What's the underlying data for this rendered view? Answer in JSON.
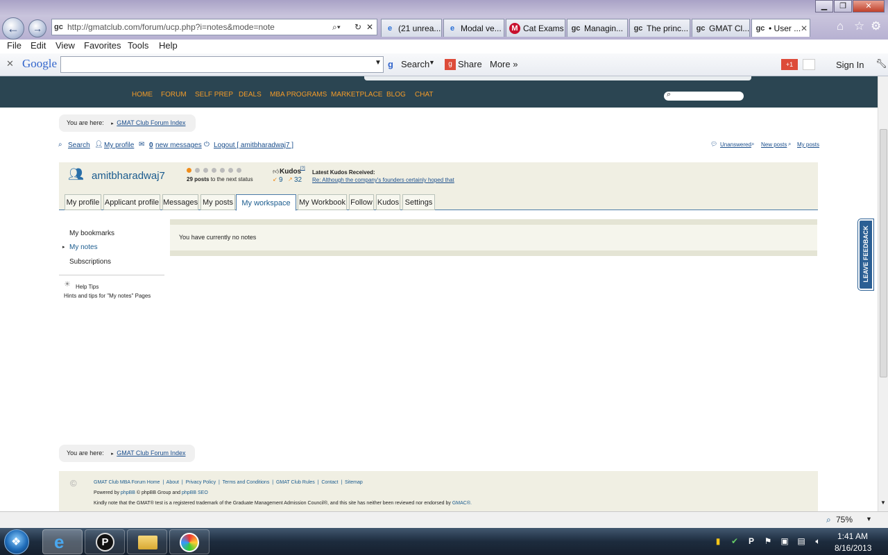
{
  "browser": {
    "url": "http://gmatclub.com/forum/ucp.php?i=notes&mode=note",
    "tabs": [
      "(21 unrea...",
      "Modal ve...",
      "Cat Exams",
      "Managin...",
      "The princ...",
      "GMAT Cl...",
      "• User ..."
    ],
    "tab_icons": [
      "ie-icon",
      "ie-icon",
      "cat-icon",
      "gc-icon",
      "gc-icon",
      "gc-icon",
      "gc-icon"
    ],
    "menu": [
      "File",
      "Edit",
      "View",
      "Favorites",
      "Tools",
      "Help"
    ],
    "google_toolbar": {
      "logo": "Google",
      "search": "Search",
      "share": "Share",
      "more": "More",
      "sign_in": "Sign In",
      "plus_one": "+1"
    },
    "zoom": "75%"
  },
  "site_nav": [
    "HOME",
    "FORUM",
    "SELF PREP",
    "DEALS",
    "MBA PROGRAMS",
    "MARKETPLACE",
    "BLOG",
    "CHAT"
  ],
  "breadcrumb": {
    "label": "You are here:",
    "link": "GMAT Club Forum Index"
  },
  "user_links": {
    "search": "Search",
    "profile": "My profile",
    "messages_count": "0",
    "messages": "new messages",
    "logout": "Logout [ amitbharadwaj7 ]"
  },
  "right_links": [
    "Unanswered",
    "New posts",
    "My posts"
  ],
  "profile": {
    "username": "amitbharadwaj7",
    "posts_count": "29 posts",
    "posts_text": "to the next status",
    "kudos_label": "Kudos",
    "kudos_superscript": "[?]",
    "kudos_given": "9",
    "kudos_received": "32",
    "latest_kudos_label": "Latest Kudos Received:",
    "latest_kudos_link": "Re: Although the company's founders certainly hoped that"
  },
  "profile_tabs": [
    "My profile",
    "Applicant profile",
    "Messages",
    "My posts",
    "My workspace",
    "My Workbook",
    "Follow",
    "Kudos",
    "Settings"
  ],
  "sidebar": {
    "items": [
      "My bookmarks",
      "My notes",
      "Subscriptions"
    ],
    "help_title": "Help Tips",
    "help_text": "Hints and tips for \"My notes\" Pages"
  },
  "notes_message": "You have currently no notes",
  "feedback": "LEAVE FEEDBACK",
  "footer": {
    "copyright_symbol": "©",
    "links": [
      "GMAT Club MBA Forum Home",
      "About",
      "Privacy Policy",
      "Terms and Conditions",
      "GMAT Club Rules",
      "Contact",
      "Sitemap"
    ],
    "powered_1": "Powered by",
    "phpbb": "phpBB",
    "powered_2": "© phpBB Group and",
    "phpbb_seo": "phpBB SEO",
    "trademark": "Kindly note that the GMAT® test is a registered trademark of the Graduate Management Admission Council®, and this site has neither been reviewed nor endorsed by",
    "gmac": "GMAC®."
  },
  "taskbar": {
    "time": "1:41 AM",
    "date": "8/16/2013"
  }
}
